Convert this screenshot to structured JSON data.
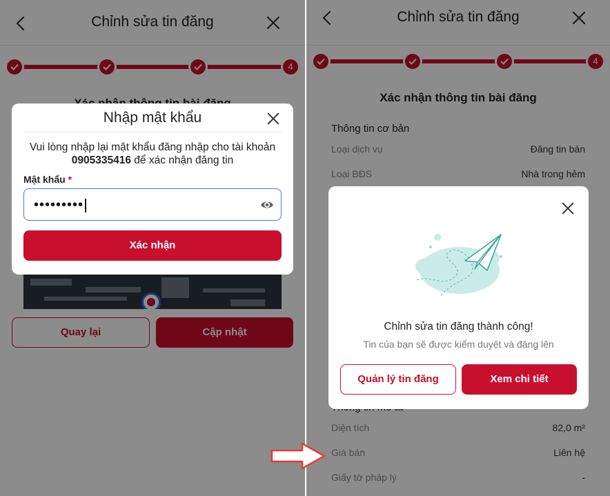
{
  "left_screen": {
    "header": {
      "title": "Chỉnh sửa tin đăng"
    },
    "stepper": {
      "last_step": "4"
    },
    "card_title": "Xác nhận thông tin bài đăng",
    "bottom": {
      "back_label": "Quay lại",
      "update_label": "Cập nhật"
    },
    "password_modal": {
      "title": "Nhập mật khẩu",
      "message_prefix": "Vui lòng nhập lại mật khẩu đăng nhập cho tài khoản",
      "phone": "0905335416",
      "message_suffix": "để xác nhận đăng tin",
      "field_label": "Mật khẩu",
      "required_mark": "*",
      "masked_value": "•••••••••",
      "confirm_label": "Xác nhận"
    }
  },
  "right_screen": {
    "header": {
      "title": "Chỉnh sửa tin đăng"
    },
    "stepper": {
      "last_step": "4"
    },
    "card_title": "Xác nhận thông tin bài đăng",
    "basic_info": {
      "heading": "Thông tin cơ bản",
      "rows": [
        {
          "key": "Loại dịch vụ",
          "value": "Đăng tin bán"
        },
        {
          "key": "Loại BĐS",
          "value": "Nhà trong hẻm"
        }
      ]
    },
    "description_info": {
      "heading": "Thông tin mô tả",
      "rows": [
        {
          "key": "Diện tích",
          "value": "82,0 m²"
        },
        {
          "key": "Giá bán",
          "value": "Liên hệ"
        },
        {
          "key": "Giấy tờ pháp lý",
          "value": "-"
        }
      ]
    },
    "success_modal": {
      "title": "Chỉnh sửa tin đăng thành công!",
      "subtitle": "Tin của bạn sẽ được kiểm duyệt và đăng lên",
      "manage_label": "Quản lý tin đăng",
      "detail_label": "Xem chi tiết"
    }
  },
  "colors": {
    "primary": "#c8102e",
    "input_border": "#4a7bd0",
    "annotation_arrow": "#e53935",
    "illustration_cloud": "#c9ece8"
  }
}
